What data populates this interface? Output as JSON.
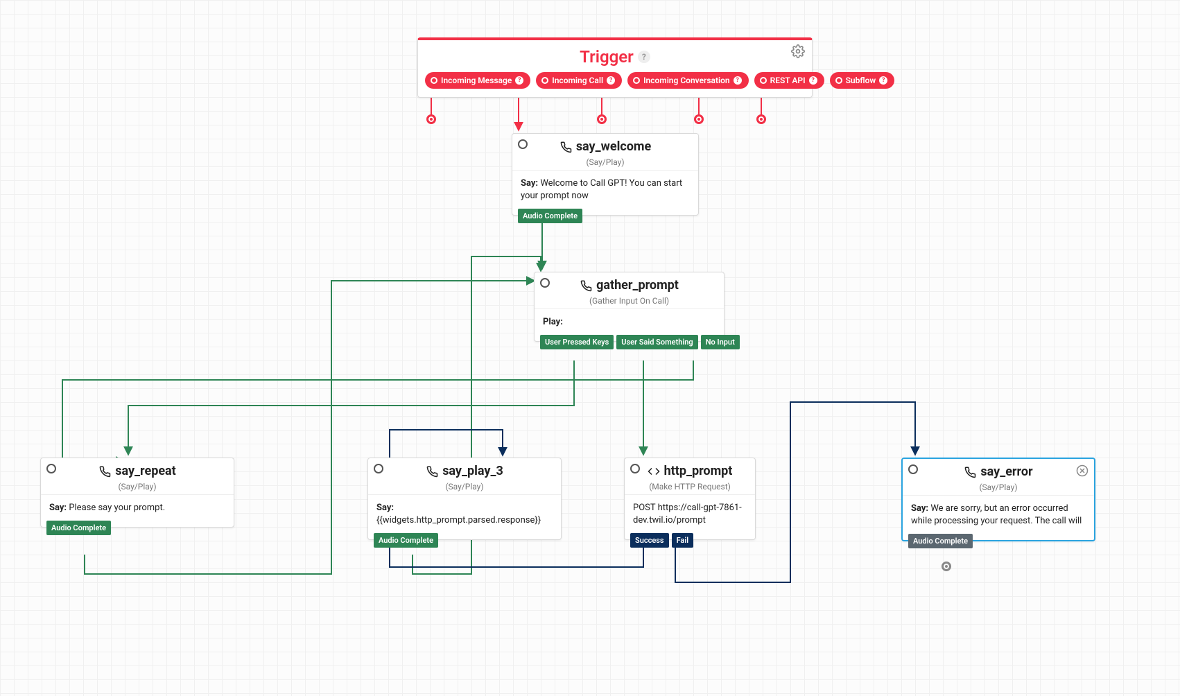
{
  "trigger": {
    "title": "Trigger",
    "events": [
      {
        "label": "Incoming Message"
      },
      {
        "label": "Incoming Call"
      },
      {
        "label": "Incoming Conversation"
      },
      {
        "label": "REST API"
      },
      {
        "label": "Subflow"
      }
    ]
  },
  "widgets": {
    "say_welcome": {
      "name": "say_welcome",
      "type": "(Say/Play)",
      "body_label": "Say:",
      "body_text": "Welcome to Call GPT! You can start your prompt now",
      "outputs": [
        {
          "label": "Audio Complete",
          "style": "green"
        }
      ]
    },
    "gather_prompt": {
      "name": "gather_prompt",
      "type": "(Gather Input On Call)",
      "body_label": "Play:",
      "body_text": "",
      "outputs": [
        {
          "label": "User Pressed Keys",
          "style": "green"
        },
        {
          "label": "User Said Something",
          "style": "green"
        },
        {
          "label": "No Input",
          "style": "green"
        }
      ]
    },
    "say_repeat": {
      "name": "say_repeat",
      "type": "(Say/Play)",
      "body_label": "Say:",
      "body_text": "Please say your prompt.",
      "outputs": [
        {
          "label": "Audio Complete",
          "style": "green"
        }
      ]
    },
    "say_play_3": {
      "name": "say_play_3",
      "type": "(Say/Play)",
      "body_label": "Say:",
      "body_text": "{{widgets.http_prompt.parsed.response}}",
      "outputs": [
        {
          "label": "Audio Complete",
          "style": "green"
        }
      ]
    },
    "http_prompt": {
      "name": "http_prompt",
      "type": "(Make HTTP Request)",
      "body_label": "",
      "body_text": "POST https://call-gpt-7861-dev.twil.io/prompt",
      "outputs": [
        {
          "label": "Success",
          "style": "navy"
        },
        {
          "label": "Fail",
          "style": "navy"
        }
      ]
    },
    "say_error": {
      "name": "say_error",
      "type": "(Say/Play)",
      "body_label": "Say:",
      "body_text": "We are sorry, but an error occurred while processing your request. The call will",
      "outputs": [
        {
          "label": "Audio Complete",
          "style": "gray"
        }
      ],
      "selected": true
    }
  }
}
